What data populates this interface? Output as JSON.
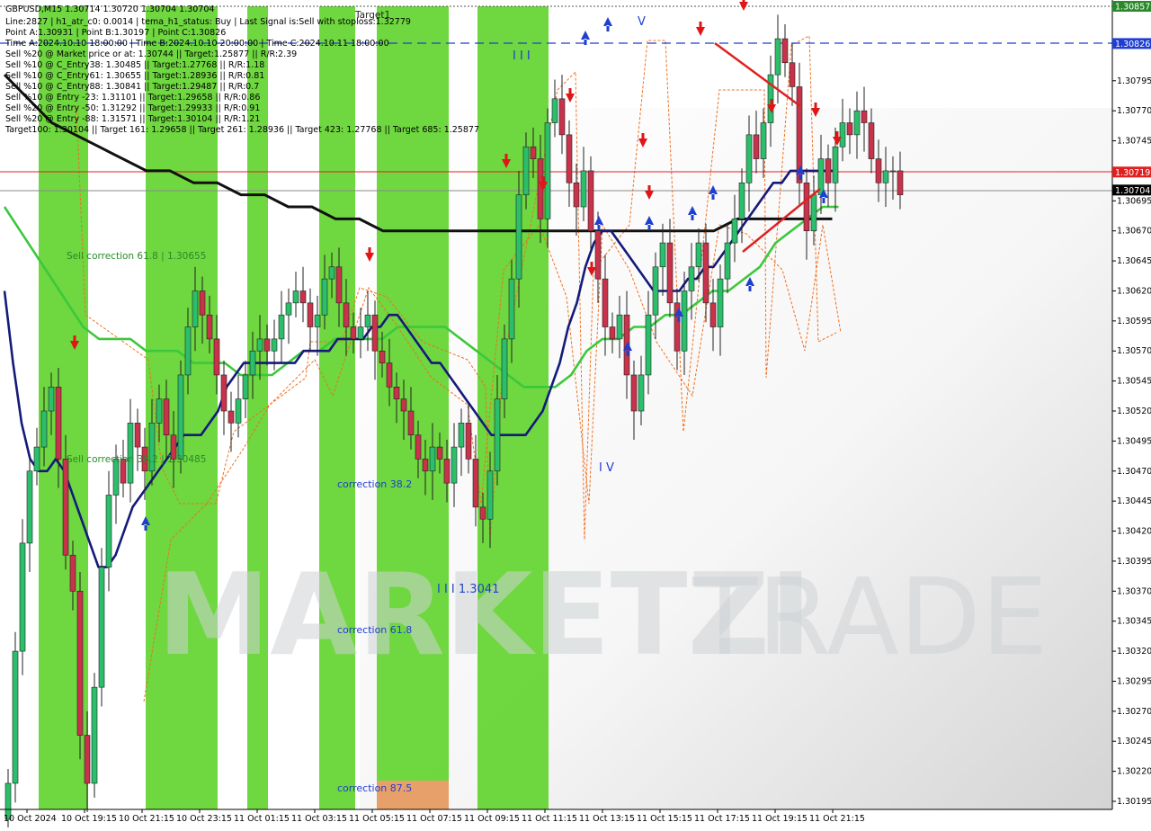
{
  "chart_data": {
    "type": "candlestick",
    "symbol_line": "GBPUSD,M15  1.30714 1.30720 1.30704 1.30704",
    "info_lines": [
      "Line:2827 | h1_atr_c0: 0.0014 | tema_h1_status: Buy | Last Signal is:Sell with stoploss:1.32779",
      "Point A:1.30931 | Point B:1.30197 | Point C:1.30826",
      "Time A:2024.10.10 18:00:00 | Time B:2024.10.10 20:00:00 | Time C:2024.10.11 18:00:00",
      "Sell %20 @ Market price or at: 1.30744 || Target:1.25877 || R/R:2.39",
      "Sell %10 @ C_Entry38: 1.30485 || Target:1.27768 || R/R:1.18",
      "Sell %10 @ C_Entry61: 1.30655 || Target:1.28936 || R/R:0.81",
      "Sell %10 @ C_Entry88: 1.30841 || Target:1.29487 || R/R:0.7",
      "Sell %10 @ Entry -23: 1.31101 || Target:1.29658 || R/R:0.86",
      "Sell %20 @ Entry -50: 1.31292 || Target:1.29933 || R/R:0.91",
      "Sell %20 @ Entry -88: 1.31571 || Target:1.30104 || R/R:1.21",
      "Target100: 1.30104 || Target 161: 1.29658 || Target 261: 1.28936 || Target 423: 1.27768 || Target 685: 1.25877"
    ],
    "y_ticks": [
      "1.30857",
      "1.30826",
      "1.30795",
      "1.30770",
      "1.30745",
      "1.30719",
      "1.30704",
      "1.30695",
      "1.30670",
      "1.30645",
      "1.30620",
      "1.30595",
      "1.30570",
      "1.30545",
      "1.30520",
      "1.30495",
      "1.30470",
      "1.30445",
      "1.30420",
      "1.30395",
      "1.30370",
      "1.30345",
      "1.30320",
      "1.30295",
      "1.30270",
      "1.30245",
      "1.30220",
      "1.30195"
    ],
    "x_ticks": [
      "10 Oct 2024",
      "10 Oct 19:15",
      "10 Oct 21:15",
      "10 Oct 23:15",
      "11 Oct 01:15",
      "11 Oct 03:15",
      "11 Oct 05:15",
      "11 Oct 07:15",
      "11 Oct 09:15",
      "11 Oct 11:15",
      "11 Oct 13:15",
      "11 Oct 15:15",
      "11 Oct 17:15",
      "11 Oct 19:15",
      "11 Oct 21:15"
    ],
    "ylim": [
      1.30185,
      1.30865
    ],
    "price_tags": [
      {
        "value": "1.30857",
        "color": "#2a8a2a"
      },
      {
        "value": "1.30826",
        "color": "#1f3fd1"
      },
      {
        "value": "1.30719",
        "color": "#e02020"
      },
      {
        "value": "1.30704",
        "color": "#000000"
      }
    ],
    "annotations": [
      "Target1",
      "Sell correction 61.8 | 1.30655",
      "Sell correction 38.2 | 1.30485",
      "correction 38.2",
      "correction 61.8",
      "correction 87.5",
      "I I I 1.3041",
      "I I I",
      "I V",
      "V"
    ],
    "watermark": [
      "MARKETZI",
      "TRADE"
    ],
    "close_series": [
      1.3021,
      1.3032,
      1.3041,
      1.3047,
      1.3049,
      1.3052,
      1.3054,
      1.3048,
      1.304,
      1.3037,
      1.3025,
      1.3021,
      1.3029,
      1.3039,
      1.3045,
      1.3048,
      1.3046,
      1.3051,
      1.3049,
      1.3047,
      1.3051,
      1.3053,
      1.305,
      1.3048,
      1.3055,
      1.3059,
      1.3062,
      1.306,
      1.3058,
      1.3055,
      1.3052,
      1.3051,
      1.3053,
      1.3055,
      1.3057,
      1.3058,
      1.3057,
      1.3058,
      1.306,
      1.3061,
      1.3062,
      1.3061,
      1.3059,
      1.306,
      1.3063,
      1.3064,
      1.3061,
      1.3059,
      1.3058,
      1.3059,
      1.306,
      1.3057,
      1.3056,
      1.3054,
      1.3053,
      1.3052,
      1.305,
      1.3048,
      1.3047,
      1.3049,
      1.3048,
      1.3046,
      1.3049,
      1.3051,
      1.3048,
      1.3044,
      1.3043,
      1.3047,
      1.3053,
      1.3058,
      1.3063,
      1.307,
      1.3074,
      1.3073,
      1.3068,
      1.3076,
      1.3078,
      1.3075,
      1.3071,
      1.3069,
      1.3072,
      1.3067,
      1.3063,
      1.3059,
      1.3058,
      1.306,
      1.3055,
      1.3052,
      1.3055,
      1.306,
      1.3064,
      1.3066,
      1.3061,
      1.3057,
      1.3062,
      1.3064,
      1.3066,
      1.3061,
      1.3059,
      1.3063,
      1.3066,
      1.3068,
      1.3071,
      1.3075,
      1.3073,
      1.3076,
      1.308,
      1.3083,
      1.3081,
      1.3079,
      1.3071,
      1.3067,
      1.307,
      1.3073,
      1.3071,
      1.3074,
      1.3076,
      1.3075,
      1.3077,
      1.3076,
      1.3073,
      1.3071,
      1.3072,
      1.3072,
      1.307
    ],
    "ema_series": {
      "dark_blue": [
        1.3062,
        1.3056,
        1.3051,
        1.3048,
        1.3047,
        1.3047,
        1.3048,
        1.3047,
        1.3045,
        1.3043,
        1.3041,
        1.3039,
        1.3039,
        1.304,
        1.3042,
        1.3044,
        1.3045,
        1.3046,
        1.3047,
        1.3048,
        1.3049,
        1.305,
        1.305,
        1.305,
        1.3051,
        1.3052,
        1.3054,
        1.3055,
        1.3056,
        1.3056,
        1.3056,
        1.3056,
        1.3056,
        1.3056,
        1.3056,
        1.3057,
        1.3057,
        1.3057,
        1.3057,
        1.3058,
        1.3058,
        1.3058,
        1.3058,
        1.3059,
        1.3059,
        1.306,
        1.306,
        1.3059,
        1.3058,
        1.3057,
        1.3056,
        1.3056,
        1.3055,
        1.3054,
        1.3053,
        1.3052,
        1.3051,
        1.305,
        1.305,
        1.305,
        1.305,
        1.305,
        1.3051,
        1.3052,
        1.3054,
        1.3056,
        1.3059,
        1.3061,
        1.3064,
        1.3066,
        1.3067,
        1.3067,
        1.3066,
        1.3065,
        1.3064,
        1.3063,
        1.3062,
        1.3062,
        1.3062,
        1.3062,
        1.3063,
        1.3063,
        1.3064,
        1.3064,
        1.3065,
        1.3066,
        1.3067,
        1.3068,
        1.3069,
        1.307,
        1.3071,
        1.3071,
        1.3072,
        1.3072,
        1.3072,
        1.3072,
        1.3072,
        1.3072
      ],
      "green": [
        1.3069,
        1.3067,
        1.3065,
        1.3063,
        1.3061,
        1.3059,
        1.3058,
        1.3058,
        1.3058,
        1.3057,
        1.3057,
        1.3057,
        1.3056,
        1.3056,
        1.3056,
        1.3055,
        1.3055,
        1.3055,
        1.3056,
        1.3057,
        1.3057,
        1.3058,
        1.3058,
        1.3058,
        1.3058,
        1.3059,
        1.3059,
        1.3059,
        1.3059,
        1.3058,
        1.3057,
        1.3056,
        1.3055,
        1.3054,
        1.3054,
        1.3054,
        1.3055,
        1.3057,
        1.3058,
        1.3058,
        1.3059,
        1.3059,
        1.306,
        1.306,
        1.3061,
        1.3062,
        1.3062,
        1.3063,
        1.3064,
        1.3066,
        1.3067,
        1.3068,
        1.3069,
        1.3069
      ],
      "black": [
        1.308,
        1.3078,
        1.3076,
        1.3075,
        1.3074,
        1.3073,
        1.3072,
        1.3072,
        1.3071,
        1.3071,
        1.307,
        1.307,
        1.3069,
        1.3069,
        1.3068,
        1.3068,
        1.3067,
        1.3067,
        1.3067,
        1.3067,
        1.3067,
        1.3067,
        1.3067,
        1.3067,
        1.3067,
        1.3067,
        1.3067,
        1.3067,
        1.3067,
        1.3067,
        1.3067,
        1.3068,
        1.3068,
        1.3068,
        1.3068,
        1.3068
      ]
    },
    "grid": false,
    "legend": "none"
  }
}
